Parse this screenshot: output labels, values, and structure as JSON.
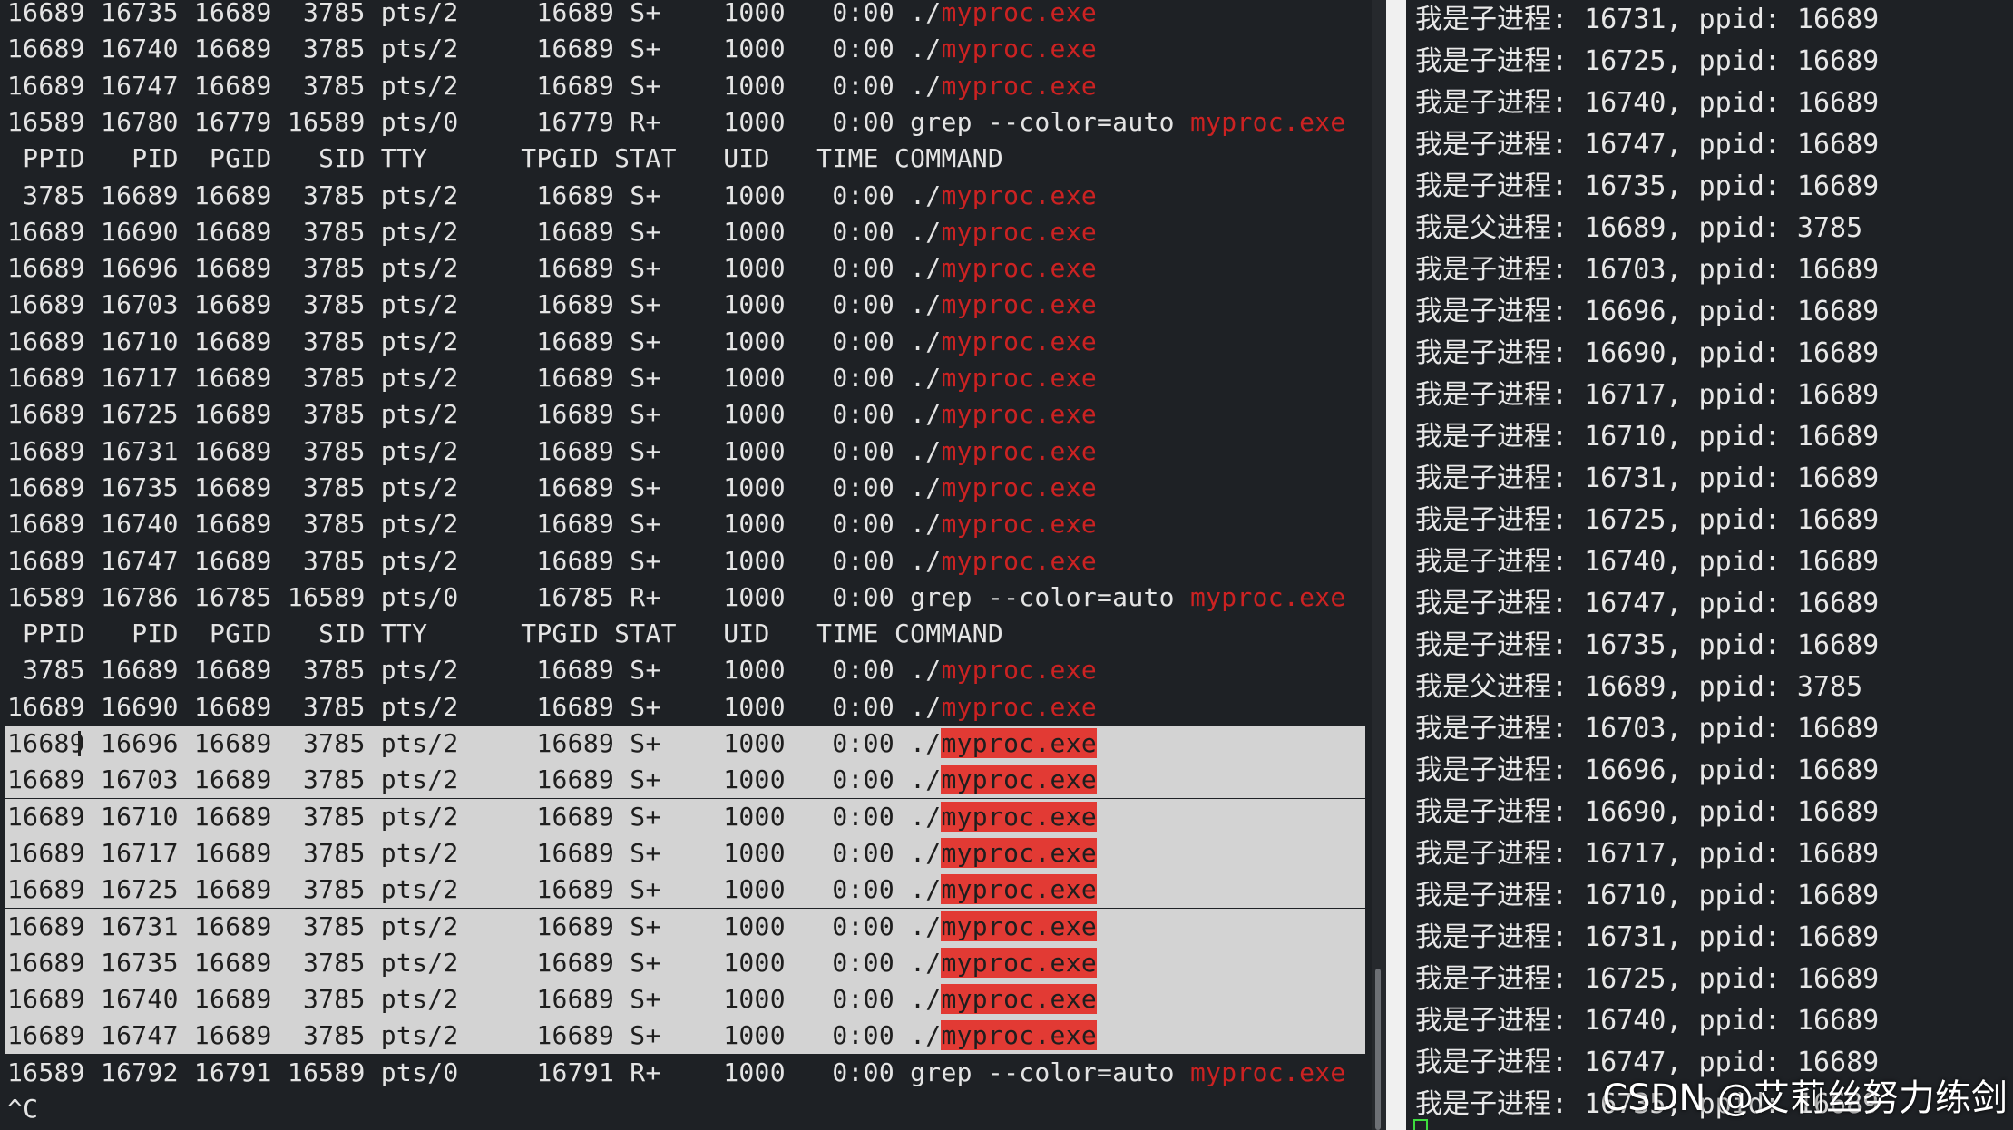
{
  "left_terminal": {
    "lines": [
      {
        "prefix": "16689 16735 16689  3785 pts/2     16689 S+    1000   0:00 ./",
        "match": "myproc.exe",
        "suffix": "",
        "selected": false
      },
      {
        "prefix": "16689 16740 16689  3785 pts/2     16689 S+    1000   0:00 ./",
        "match": "myproc.exe",
        "suffix": "",
        "selected": false
      },
      {
        "prefix": "16689 16747 16689  3785 pts/2     16689 S+    1000   0:00 ./",
        "match": "myproc.exe",
        "suffix": "",
        "selected": false
      },
      {
        "prefix": "16589 16780 16779 16589 pts/0     16779 R+    1000   0:00 grep --color=auto ",
        "match": "myproc.exe",
        "suffix": "",
        "selected": false
      },
      {
        "prefix": " PPID   PID  PGID   SID TTY      TPGID STAT   UID   TIME COMMAND",
        "match": "",
        "suffix": "",
        "selected": false
      },
      {
        "prefix": " 3785 16689 16689  3785 pts/2     16689 S+    1000   0:00 ./",
        "match": "myproc.exe",
        "suffix": "",
        "selected": false
      },
      {
        "prefix": "16689 16690 16689  3785 pts/2     16689 S+    1000   0:00 ./",
        "match": "myproc.exe",
        "suffix": "",
        "selected": false
      },
      {
        "prefix": "16689 16696 16689  3785 pts/2     16689 S+    1000   0:00 ./",
        "match": "myproc.exe",
        "suffix": "",
        "selected": false
      },
      {
        "prefix": "16689 16703 16689  3785 pts/2     16689 S+    1000   0:00 ./",
        "match": "myproc.exe",
        "suffix": "",
        "selected": false
      },
      {
        "prefix": "16689 16710 16689  3785 pts/2     16689 S+    1000   0:00 ./",
        "match": "myproc.exe",
        "suffix": "",
        "selected": false
      },
      {
        "prefix": "16689 16717 16689  3785 pts/2     16689 S+    1000   0:00 ./",
        "match": "myproc.exe",
        "suffix": "",
        "selected": false
      },
      {
        "prefix": "16689 16725 16689  3785 pts/2     16689 S+    1000   0:00 ./",
        "match": "myproc.exe",
        "suffix": "",
        "selected": false
      },
      {
        "prefix": "16689 16731 16689  3785 pts/2     16689 S+    1000   0:00 ./",
        "match": "myproc.exe",
        "suffix": "",
        "selected": false
      },
      {
        "prefix": "16689 16735 16689  3785 pts/2     16689 S+    1000   0:00 ./",
        "match": "myproc.exe",
        "suffix": "",
        "selected": false
      },
      {
        "prefix": "16689 16740 16689  3785 pts/2     16689 S+    1000   0:00 ./",
        "match": "myproc.exe",
        "suffix": "",
        "selected": false
      },
      {
        "prefix": "16689 16747 16689  3785 pts/2     16689 S+    1000   0:00 ./",
        "match": "myproc.exe",
        "suffix": "",
        "selected": false
      },
      {
        "prefix": "16589 16786 16785 16589 pts/0     16785 R+    1000   0:00 grep --color=auto ",
        "match": "myproc.exe",
        "suffix": "",
        "selected": false
      },
      {
        "prefix": " PPID   PID  PGID   SID TTY      TPGID STAT   UID   TIME COMMAND",
        "match": "",
        "suffix": "",
        "selected": false
      },
      {
        "prefix": " 3785 16689 16689  3785 pts/2     16689 S+    1000   0:00 ./",
        "match": "myproc.exe",
        "suffix": "",
        "selected": false
      },
      {
        "prefix": "16689 16690 16689  3785 pts/2     16689 S+    1000   0:00 ./",
        "match": "myproc.exe",
        "suffix": "",
        "selected": false
      },
      {
        "prefix": "16689 16696 16689  3785 pts/2     16689 S+    1000   0:00 ./",
        "match": "myproc.exe",
        "suffix": "",
        "selected": true
      },
      {
        "prefix": "16689 16703 16689  3785 pts/2     16689 S+    1000   0:00 ./",
        "match": "myproc.exe",
        "suffix": "",
        "selected": true
      },
      {
        "prefix": "16689 16710 16689  3785 pts/2     16689 S+    1000   0:00 ./",
        "match": "myproc.exe",
        "suffix": "",
        "selected": true
      },
      {
        "prefix": "16689 16717 16689  3785 pts/2     16689 S+    1000   0:00 ./",
        "match": "myproc.exe",
        "suffix": "",
        "selected": true
      },
      {
        "prefix": "16689 16725 16689  3785 pts/2     16689 S+    1000   0:00 ./",
        "match": "myproc.exe",
        "suffix": "",
        "selected": true
      },
      {
        "prefix": "16689 16731 16689  3785 pts/2     16689 S+    1000   0:00 ./",
        "match": "myproc.exe",
        "suffix": "",
        "selected": true
      },
      {
        "prefix": "16689 16735 16689  3785 pts/2     16689 S+    1000   0:00 ./",
        "match": "myproc.exe",
        "suffix": "",
        "selected": true
      },
      {
        "prefix": "16689 16740 16689  3785 pts/2     16689 S+    1000   0:00 ./",
        "match": "myproc.exe",
        "suffix": "",
        "selected": true
      },
      {
        "prefix": "16689 16747 16689  3785 pts/2     16689 S+    1000   0:00 ./",
        "match": "myproc.exe",
        "suffix": "",
        "selected": true
      },
      {
        "prefix": "16589 16792 16791 16589 pts/0     16791 R+    1000   0:00 grep --color=auto ",
        "match": "myproc.exe",
        "suffix": "",
        "selected": false
      },
      {
        "prefix": "^C",
        "match": "",
        "suffix": "",
        "selected": false
      }
    ]
  },
  "right_terminal": {
    "lines": [
      "我是子进程: 16731, ppid: 16689",
      "我是子进程: 16725, ppid: 16689",
      "我是子进程: 16740, ppid: 16689",
      "我是子进程: 16747, ppid: 16689",
      "我是子进程: 16735, ppid: 16689",
      "我是父进程: 16689, ppid: 3785",
      "我是子进程: 16703, ppid: 16689",
      "我是子进程: 16696, ppid: 16689",
      "我是子进程: 16690, ppid: 16689",
      "我是子进程: 16717, ppid: 16689",
      "我是子进程: 16710, ppid: 16689",
      "我是子进程: 16731, ppid: 16689",
      "我是子进程: 16725, ppid: 16689",
      "我是子进程: 16740, ppid: 16689",
      "我是子进程: 16747, ppid: 16689",
      "我是子进程: 16735, ppid: 16689",
      "我是父进程: 16689, ppid: 3785",
      "我是子进程: 16703, ppid: 16689",
      "我是子进程: 16696, ppid: 16689",
      "我是子进程: 16690, ppid: 16689",
      "我是子进程: 16717, ppid: 16689",
      "我是子进程: 16710, ppid: 16689",
      "我是子进程: 16731, ppid: 16689",
      "我是子进程: 16725, ppid: 16689",
      "我是子进程: 16740, ppid: 16689",
      "我是子进程: 16747, ppid: 16689",
      "我是子进程: 16735, ppid: 16689"
    ]
  },
  "watermark": "CSDN @艾莉丝努力练剑",
  "colors": {
    "background": "#1e2125",
    "text": "#e4e4e4",
    "match_highlight": "#cc2222",
    "selection": "#d3d3d3",
    "cursor": "#3ddc3d"
  }
}
